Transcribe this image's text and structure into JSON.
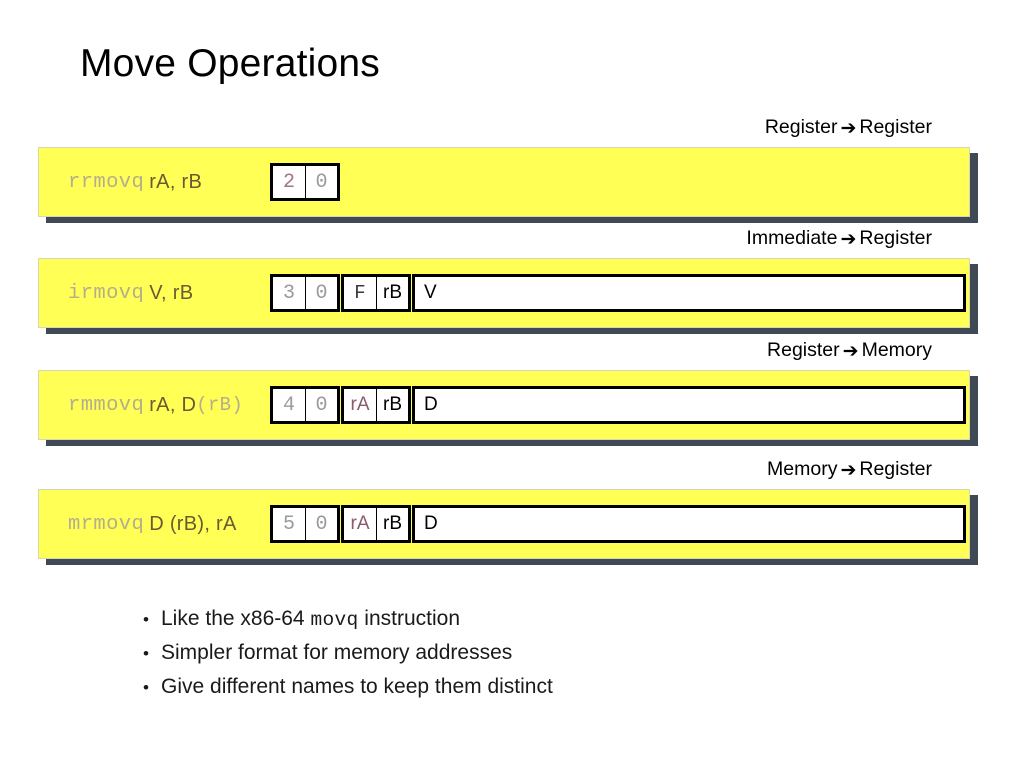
{
  "title": "Move Operations",
  "arrow_glyph": "➔",
  "colors": {
    "bar_fill": "#ffff55",
    "bar_shadow": "#404a56",
    "mnemonic_text": "#b5ae8e",
    "operand_text": "#6a5a33",
    "code_digit": "#9a9a9a",
    "highlight_register": "#8b5a6b",
    "background": "#ffffff"
  },
  "rows": [
    {
      "direction_from": "Register",
      "direction_to": "Register",
      "direction_label": "Register ➔ Register",
      "mnemonic": "rrmovq",
      "operands": "rA, rB",
      "operands_suffix": "",
      "groups": [
        {
          "cells": [
            {
              "text": "2",
              "style": "num-hl"
            },
            {
              "text": "0",
              "style": "num"
            }
          ]
        }
      ]
    },
    {
      "direction_from": "Immediate",
      "direction_to": "Register",
      "direction_label": "Immediate ➔ Register",
      "mnemonic": "irmovq",
      "operands": "V, rB",
      "operands_suffix": "",
      "groups": [
        {
          "cells": [
            {
              "text": "3",
              "style": "num"
            },
            {
              "text": "0",
              "style": "num"
            }
          ]
        },
        {
          "cells": [
            {
              "text": "F",
              "style": "fn"
            },
            {
              "text": "rB",
              "style": "reg"
            }
          ]
        },
        {
          "cells": [
            {
              "text": "V",
              "style": "reg wide"
            }
          ]
        }
      ]
    },
    {
      "direction_from": "Register",
      "direction_to": "Memory",
      "direction_label": "Register ➔ Memory",
      "mnemonic": "rmmovq",
      "operands": "rA, D",
      "operands_suffix": "(rB)",
      "groups": [
        {
          "cells": [
            {
              "text": "4",
              "style": "num"
            },
            {
              "text": "0",
              "style": "num"
            }
          ]
        },
        {
          "cells": [
            {
              "text": "rA",
              "style": "reg-hl"
            },
            {
              "text": "rB",
              "style": "reg"
            }
          ]
        },
        {
          "cells": [
            {
              "text": "D",
              "style": "reg wide"
            }
          ]
        }
      ]
    },
    {
      "direction_from": "Memory",
      "direction_to": "Register",
      "direction_label": "Memory ➔ Register",
      "mnemonic": "mrmovq",
      "operands": "D (rB), rA",
      "operands_suffix": "",
      "groups": [
        {
          "cells": [
            {
              "text": "5",
              "style": "num"
            },
            {
              "text": "0",
              "style": "num"
            }
          ]
        },
        {
          "cells": [
            {
              "text": "rA",
              "style": "reg-hl"
            },
            {
              "text": "rB",
              "style": "reg"
            }
          ]
        },
        {
          "cells": [
            {
              "text": "D",
              "style": "reg wide"
            }
          ]
        }
      ]
    }
  ],
  "bullets": [
    {
      "bullet_char": "•",
      "before": "Like the x86-64 ",
      "mono": "movq",
      "after": " instruction"
    },
    {
      "bullet_char": "•",
      "before": "Simpler format for memory addresses",
      "mono": "",
      "after": ""
    },
    {
      "bullet_char": "•",
      "before": "Give different names to keep them distinct",
      "mono": "",
      "after": ""
    }
  ]
}
